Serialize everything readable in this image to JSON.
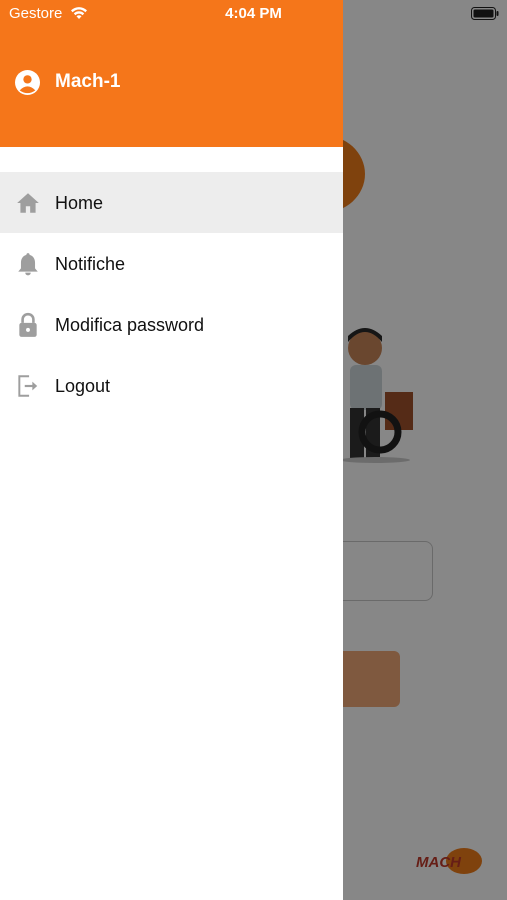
{
  "status_bar": {
    "carrier": "Gestore",
    "time": "4:04 PM"
  },
  "drawer": {
    "user_name": "Mach-1",
    "header_color": "#f5761a",
    "items": [
      {
        "label": "Home",
        "icon": "home-icon",
        "active": true
      },
      {
        "label": "Notifiche",
        "icon": "bell-icon",
        "active": false
      },
      {
        "label": "Modifica password",
        "icon": "lock-icon",
        "active": false
      },
      {
        "label": "Logout",
        "icon": "logout-icon",
        "active": false
      }
    ]
  },
  "background": {
    "logo_text": "MACH",
    "accent_color": "#f07d1a"
  }
}
